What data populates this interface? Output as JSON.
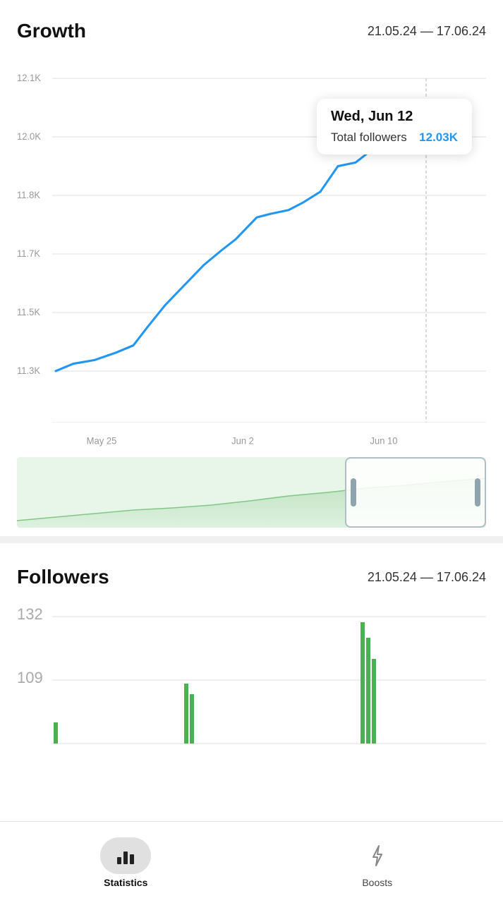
{
  "growth": {
    "title": "Growth",
    "date_range": "21.05.24 — 17.06.24",
    "tooltip": {
      "date": "Wed, Jun 12",
      "label": "Total followers",
      "value": "12.03K"
    },
    "y_labels": [
      "12.1K",
      "12.0K",
      "11.8K",
      "11.7K",
      "11.5K",
      "11.3K"
    ],
    "x_labels": [
      "May 25",
      "Jun 2",
      "Jun 10"
    ]
  },
  "followers": {
    "title": "Followers",
    "date_range": "21.05.24 — 17.06.24",
    "y_labels": [
      "132",
      "109"
    ]
  },
  "nav": {
    "statistics_label": "Statistics",
    "boosts_label": "Boosts"
  }
}
